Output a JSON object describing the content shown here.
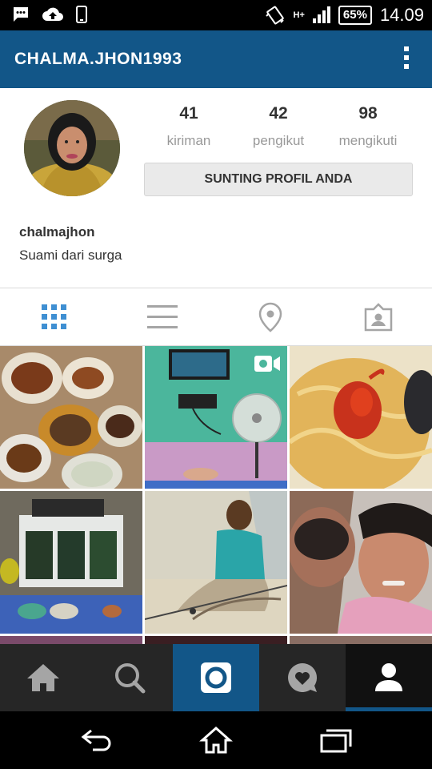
{
  "status_bar": {
    "battery": "65%",
    "time": "14.09",
    "network": "H+",
    "icons": [
      "chat-bubble-icon",
      "cloud-upload-icon",
      "phone-icon",
      "vibrate-icon",
      "signal-icon",
      "battery-icon"
    ]
  },
  "app_bar": {
    "title": "CHALMA.JHON1993",
    "menu_icon": "overflow-menu-icon"
  },
  "profile": {
    "stats": [
      {
        "value": "41",
        "label": "kiriman"
      },
      {
        "value": "42",
        "label": "pengikut"
      },
      {
        "value": "98",
        "label": "mengikuti"
      }
    ],
    "edit_button": "SUNTING PROFIL ANDA",
    "username": "chalmajhon",
    "bio": "Suami dari surga"
  },
  "view_tabs": [
    {
      "icon": "grid-icon",
      "active": true
    },
    {
      "icon": "list-icon",
      "active": false
    },
    {
      "icon": "location-pin-icon",
      "active": false
    },
    {
      "icon": "tagged-photos-icon",
      "active": false
    }
  ],
  "grid": {
    "tiles": [
      {
        "subject": "food-plates",
        "video": false
      },
      {
        "subject": "tv-and-fan",
        "video": true
      },
      {
        "subject": "noodles-with-sauce",
        "video": false
      },
      {
        "subject": "kitchen-cabinet",
        "video": false
      },
      {
        "subject": "man-fishing-rod",
        "video": false
      },
      {
        "subject": "couple-selfie",
        "video": false
      }
    ]
  },
  "bottom_nav": [
    {
      "icon": "home-icon"
    },
    {
      "icon": "search-icon"
    },
    {
      "icon": "camera-icon"
    },
    {
      "icon": "activity-heart-icon"
    },
    {
      "icon": "profile-icon",
      "active": true
    }
  ],
  "colors": {
    "brand_blue": "#125688",
    "nav_dark": "#262626",
    "stat_label": "#999999",
    "tab_active": "#3f8fd2",
    "tab_inactive": "#a5a5a5"
  }
}
